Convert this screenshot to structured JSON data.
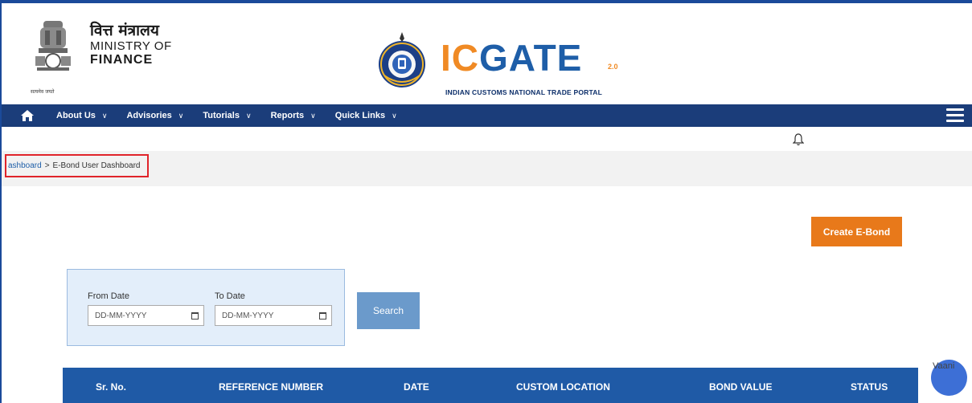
{
  "header": {
    "ministry_hindi": "वित्त मंत्रालय",
    "ministry_line1": "MINISTRY OF",
    "ministry_line2": "FINANCE",
    "emblem_caption": "सत्यमेव जयते",
    "logo_ic": "IC",
    "logo_g": "G",
    "logo_ate": "ATE",
    "logo_version": "2.0",
    "logo_subtitle": "INDIAN CUSTOMS NATIONAL TRADE PORTAL"
  },
  "nav": {
    "items": [
      {
        "label": "About Us"
      },
      {
        "label": "Advisories"
      },
      {
        "label": "Tutorials"
      },
      {
        "label": "Reports"
      },
      {
        "label": "Quick Links"
      }
    ]
  },
  "breadcrumb": {
    "link": "ashboard",
    "separator": ">",
    "current": "E-Bond User Dashboard"
  },
  "actions": {
    "create_label": "Create E-Bond",
    "search_label": "Search"
  },
  "filter": {
    "from_label": "From Date",
    "to_label": "To Date",
    "from_placeholder": "DD-MM-YYYY",
    "to_placeholder": "DD-MM-YYYY"
  },
  "table": {
    "columns": [
      "Sr. No.",
      "REFERENCE NUMBER",
      "DATE",
      "CUSTOM LOCATION",
      "BOND VALUE",
      "STATUS"
    ]
  },
  "chatbot": {
    "alt_text": "Vaani"
  },
  "colors": {
    "nav_bg": "#1b3d7a",
    "accent_orange": "#e8791a",
    "table_header": "#1f5aa6",
    "search_button": "#6b9acb"
  }
}
